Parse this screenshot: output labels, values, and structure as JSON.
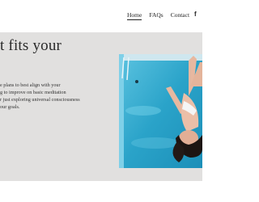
{
  "nav": {
    "items": [
      {
        "label": "Home"
      },
      {
        "label": "FAQs"
      },
      {
        "label": "Contact"
      }
    ],
    "social_icon": "facebook-icon",
    "social_glyph": "f"
  },
  "hero": {
    "headline": "t fits your",
    "body_lines": [
      "e plans to best align with your",
      "g to improve on basic meditation",
      "r just exploring universal consciousness",
      "our goals."
    ],
    "photo": "woman floating in flotation tank"
  },
  "colors": {
    "hero_bg": "#e1e0df",
    "water": "#2aa3c9",
    "text": "#2a2a2a"
  }
}
